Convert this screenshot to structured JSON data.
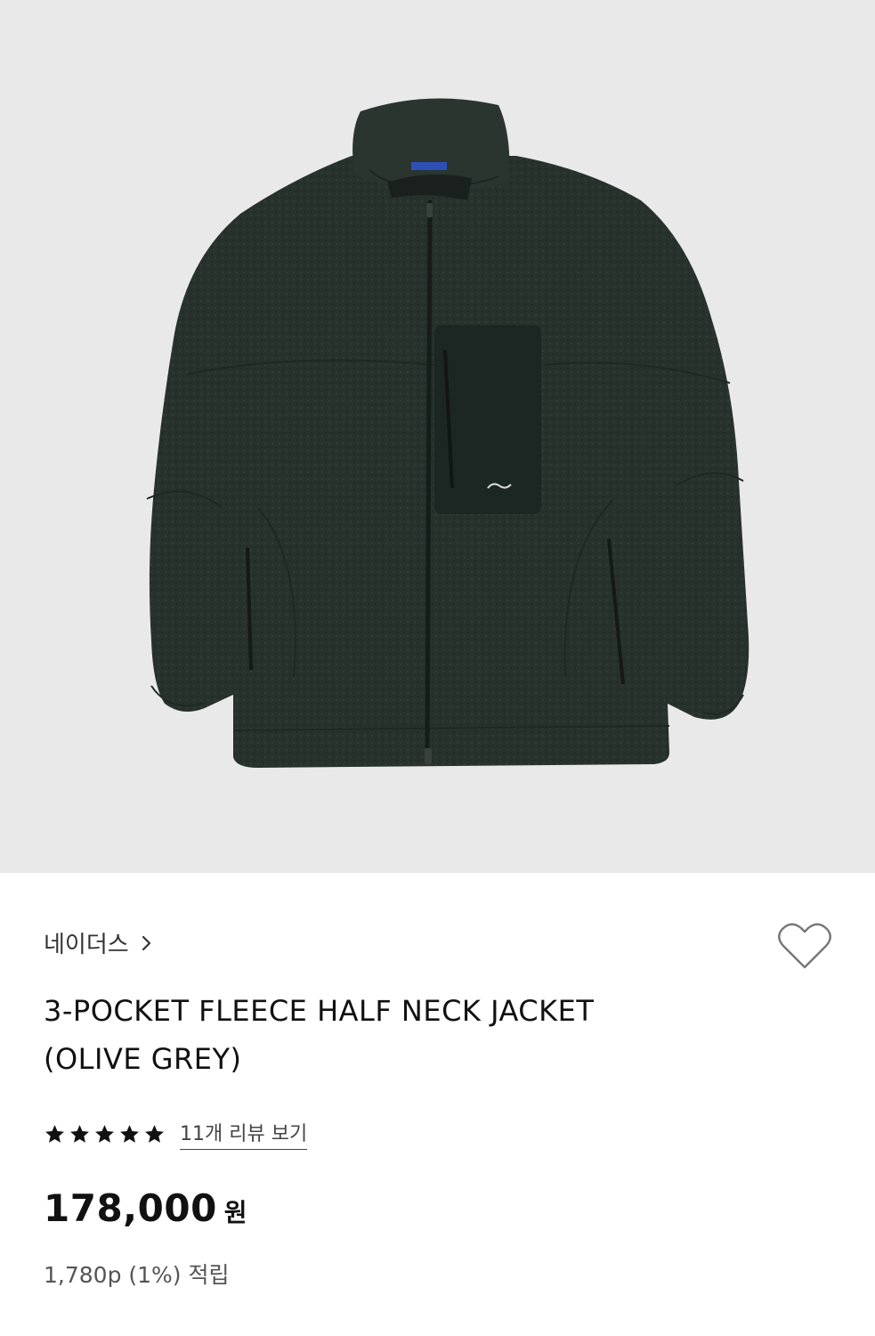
{
  "product": {
    "image_alt": "olive grey fleece jacket product photo",
    "brand": "네이더스",
    "title_line1": "3-POCKET FLEECE HALF NECK JACKET",
    "title_line2": "(OLIVE GREY)",
    "rating": 5,
    "rating_max": 5,
    "review_link": "11개 리뷰 보기",
    "price": "178,000",
    "price_unit": "원",
    "points": "1,780p (1%) 적립"
  },
  "icons": {
    "wishlist": "heart-outline-icon",
    "brand_chevron": "chevron-right-icon",
    "star": "star-filled-icon"
  },
  "colors": {
    "image_bg": "#e9e9e9",
    "jacket": "#26302b",
    "text_primary": "#111111",
    "text_secondary": "#555555"
  }
}
